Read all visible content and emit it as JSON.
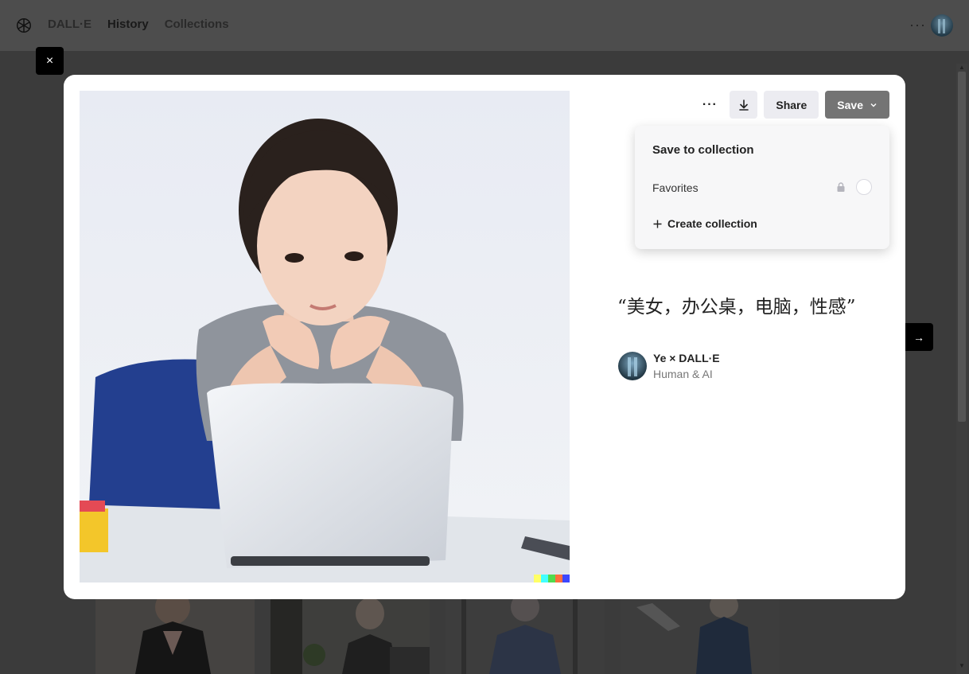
{
  "nav": {
    "brand": "DALL·E",
    "links": [
      {
        "label": "History",
        "active": true
      },
      {
        "label": "Collections",
        "active": false
      }
    ],
    "more": "···"
  },
  "modal": {
    "close_label": "×",
    "next_label": "→",
    "toolbar": {
      "more": "···",
      "share_label": "Share",
      "save_label": "Save"
    },
    "dropdown": {
      "title": "Save to collection",
      "items": [
        {
          "label": "Favorites",
          "locked": true
        }
      ],
      "create_label": "Create collection"
    },
    "prompt": "“美女，办公桌，电脑，性感”",
    "author": {
      "name": "Ye × DALL·E",
      "subtitle": "Human & AI"
    },
    "signature_colors": [
      "#ffff66",
      "#42ffff",
      "#51da4c",
      "#ff6e3c",
      "#3c46ff"
    ]
  }
}
